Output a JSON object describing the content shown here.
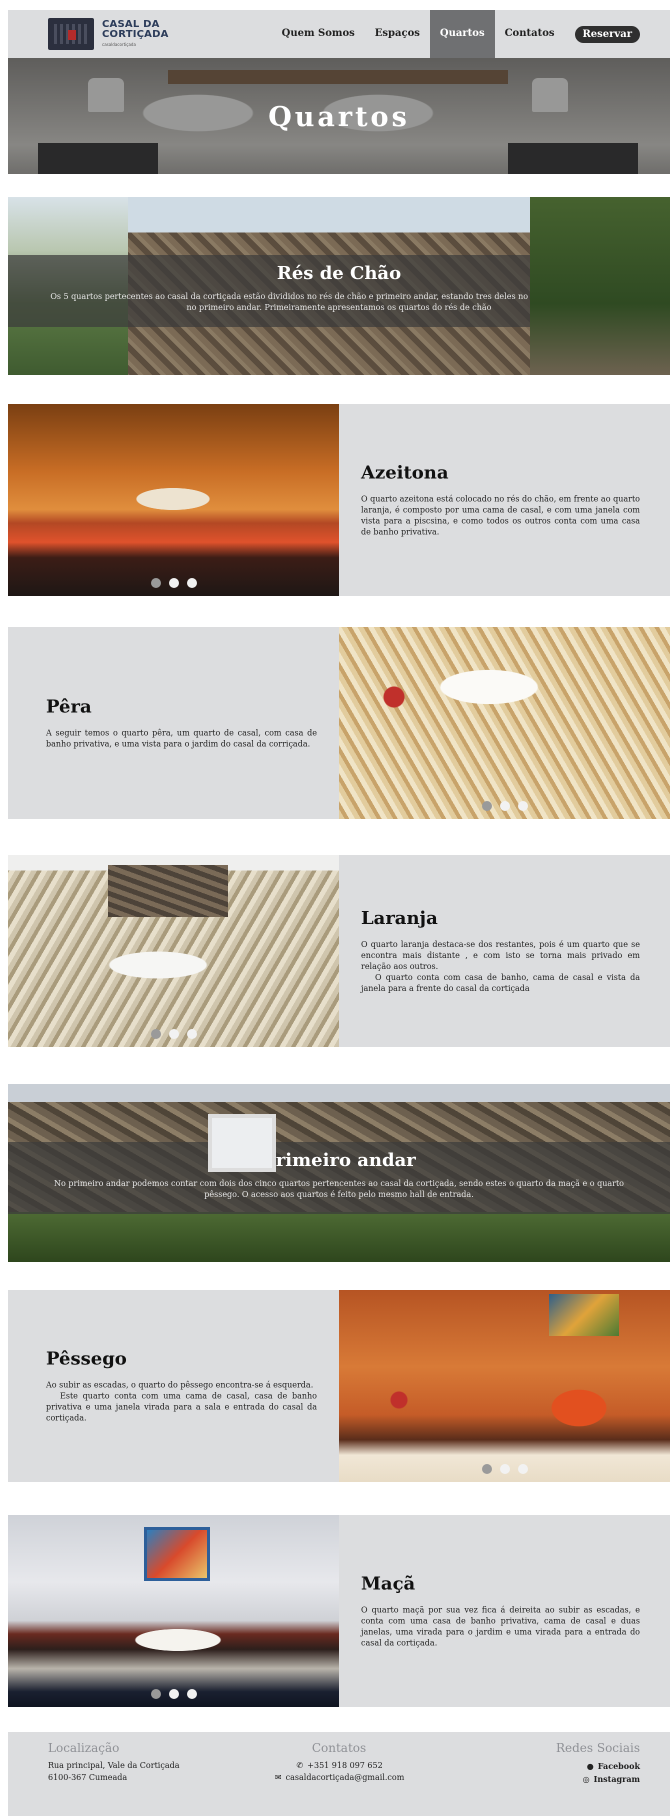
{
  "nav": {
    "logo_line1": "CASAL DA",
    "logo_line2": "CORTIÇADA",
    "logo_sub": "casaldacortiçada",
    "links": [
      "Quem Somos",
      "Espaços",
      "Quartos",
      "Contatos"
    ],
    "active": "Quartos",
    "reserve_label": "Reservar"
  },
  "hero": {
    "title": "Quartos"
  },
  "sections": {
    "res_de_chao": {
      "title": "Rés de Chão",
      "text": "Os 5 quartos pertecentes ao casal da cortiçada estão divididos no rés de chão e primeiro andar, estando tres deles no rés de chão e dois deles no primeiro andar. Primeiramente apresentamos os quartos do rés de chão"
    },
    "primeiro_andar": {
      "title": "Primeiro andar",
      "text": "No primeiro andar podemos contar com dois dos cinco quartos pertencentes ao casal da cortiçada, sendo estes o quarto da maçã e o quarto pêssego. O acesso aos quartos é feito pelo mesmo hall de entrada."
    }
  },
  "rooms": {
    "azeitona": {
      "title": "Azeitona",
      "text": "O quarto azeitona está colocado no rés do chão, em frente ao quarto laranja, é composto por uma cama de casal, e com uma janela com vista para a piscsina, e como todos os outros conta com uma casa de banho privativa."
    },
    "pera": {
      "title": "Pêra",
      "text": "A seguir temos o quarto pêra, um quarto de casal, com casa de banho privativa, e uma vista para o jardim do casal da corriçada."
    },
    "laranja": {
      "title": "Laranja",
      "text1": "O quarto laranja destaca-se dos restantes, pois é um quarto que se encontra mais distante , e com isto se torna mais privado em relação aos outros.",
      "text2": "O quarto conta com casa de banho, cama de casal e vista da janela para a frente do casal da cortiçada"
    },
    "pessego": {
      "title": "Pêssego",
      "text1": "Ao subir as escadas, o quarto do pêssego encontra-se á esquerda.",
      "text2": "Este quarto conta com uma cama de casal, casa de banho privativa e uma janela virada para a sala e entrada do casal da cortiçada."
    },
    "maca": {
      "title": "Maçã",
      "text": "O quarto maçã por sua vez fica á deireita ao subir as escadas, e conta com uma casa de banho privativa, cama de casal e duas janelas, uma virada para o jardim e uma virada para a entrada do casal da cortiçada."
    }
  },
  "footer": {
    "location": {
      "heading": "Localização",
      "line1": "Rua principal, Vale da Cortiçada",
      "line2": "6100-367 Cumeada"
    },
    "contacts": {
      "heading": "Contatos",
      "phone": "+351 918 097 652",
      "email": "casaldacortiçada@gmail.com"
    },
    "social": {
      "heading": "Redes Sociais",
      "facebook": "Facebook",
      "instagram": "Instagram"
    }
  },
  "icons": {
    "phone": "phone-icon",
    "email": "envelope-icon",
    "facebook": "facebook-icon",
    "instagram": "instagram-icon"
  }
}
